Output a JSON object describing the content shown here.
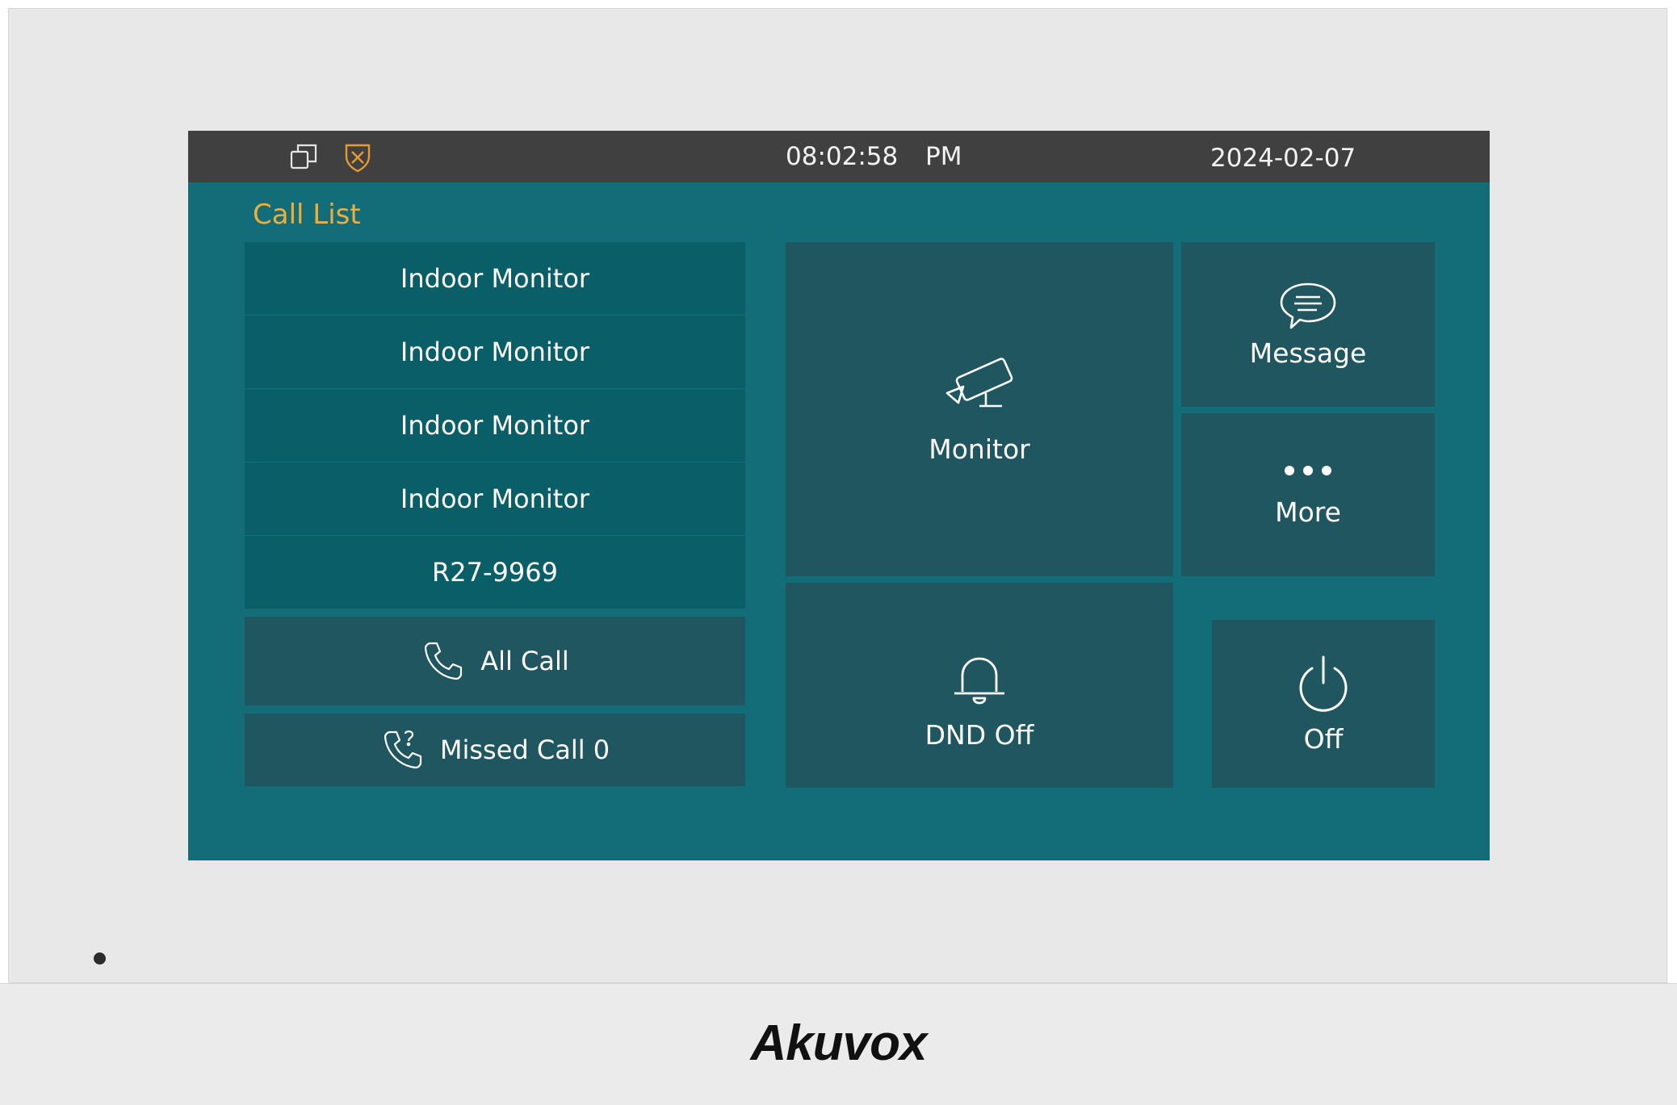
{
  "status_bar": {
    "time": "08:02:58",
    "ampm": "PM",
    "date": "2024-02-07",
    "icons": [
      "multi-window-icon",
      "shield-alarm-icon"
    ],
    "alarm_icon_color": "#e79a31"
  },
  "call_list": {
    "title": "Call List",
    "title_color": "#f0ad3a",
    "items": [
      "Indoor Monitor",
      "Indoor Monitor",
      "Indoor Monitor",
      "Indoor Monitor",
      "R27-9969"
    ],
    "all_call_label": "All Call",
    "missed_call_label": "Missed Call 0"
  },
  "tiles": {
    "monitor": "Monitor",
    "message": "Message",
    "more": "More",
    "dnd": "DND Off",
    "off": "Off"
  },
  "brand": "Akuvox"
}
